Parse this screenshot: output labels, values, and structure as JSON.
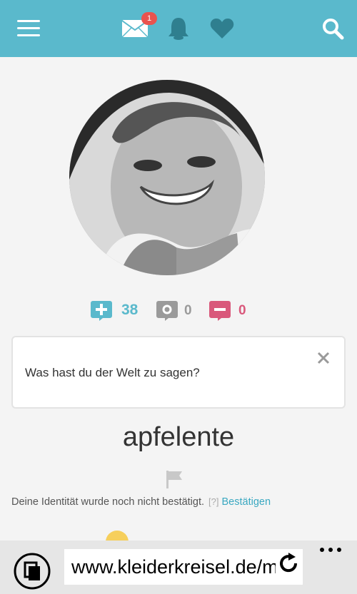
{
  "header": {
    "mail_badge_count": "1",
    "icons": [
      "menu-icon",
      "mail-icon",
      "bell-icon",
      "heart-icon",
      "search-icon"
    ],
    "bg_color": "#5ab9cc"
  },
  "profile": {
    "username": "apfelente"
  },
  "ratings": {
    "positive": "38",
    "neutral": "0",
    "negative": "0",
    "colors": {
      "positive": "#5ab9cc",
      "neutral": "#9a9a9a",
      "negative": "#d9587b"
    }
  },
  "status": {
    "text": "Was hast du der Welt zu sagen?"
  },
  "identity": {
    "text": "Deine Identität wurde noch nicht bestätigt.",
    "help": "[?]",
    "link": "Bestätigen"
  },
  "browser": {
    "url": "www.kleiderkreisel.de/mi"
  }
}
